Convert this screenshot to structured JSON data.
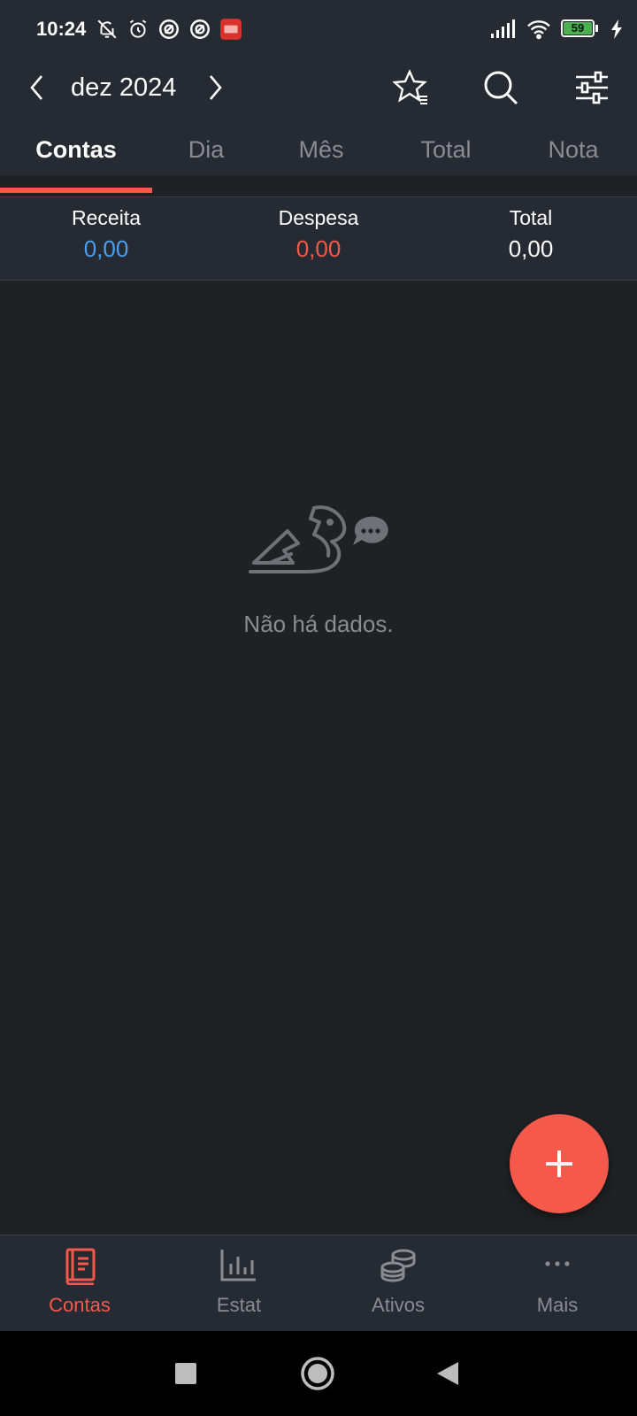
{
  "status_bar": {
    "time": "10:24",
    "battery": "59"
  },
  "header": {
    "month": "dez 2024"
  },
  "tabs": [
    {
      "label": "Contas"
    },
    {
      "label": "Dia"
    },
    {
      "label": "Mês"
    },
    {
      "label": "Total"
    },
    {
      "label": "Nota"
    }
  ],
  "summary": {
    "income_label": "Receita",
    "income_value": "0,00",
    "expense_label": "Despesa",
    "expense_value": "0,00",
    "total_label": "Total",
    "total_value": "0,00"
  },
  "empty_state": {
    "message": "Não há dados."
  },
  "bottom_nav": [
    {
      "label": "Contas"
    },
    {
      "label": "Estat"
    },
    {
      "label": "Ativos"
    },
    {
      "label": "Mais"
    }
  ],
  "colors": {
    "accent": "#f4594b",
    "income": "#4a9ff0",
    "expense": "#f4594b",
    "background": "#202124",
    "bar": "#262a33"
  }
}
